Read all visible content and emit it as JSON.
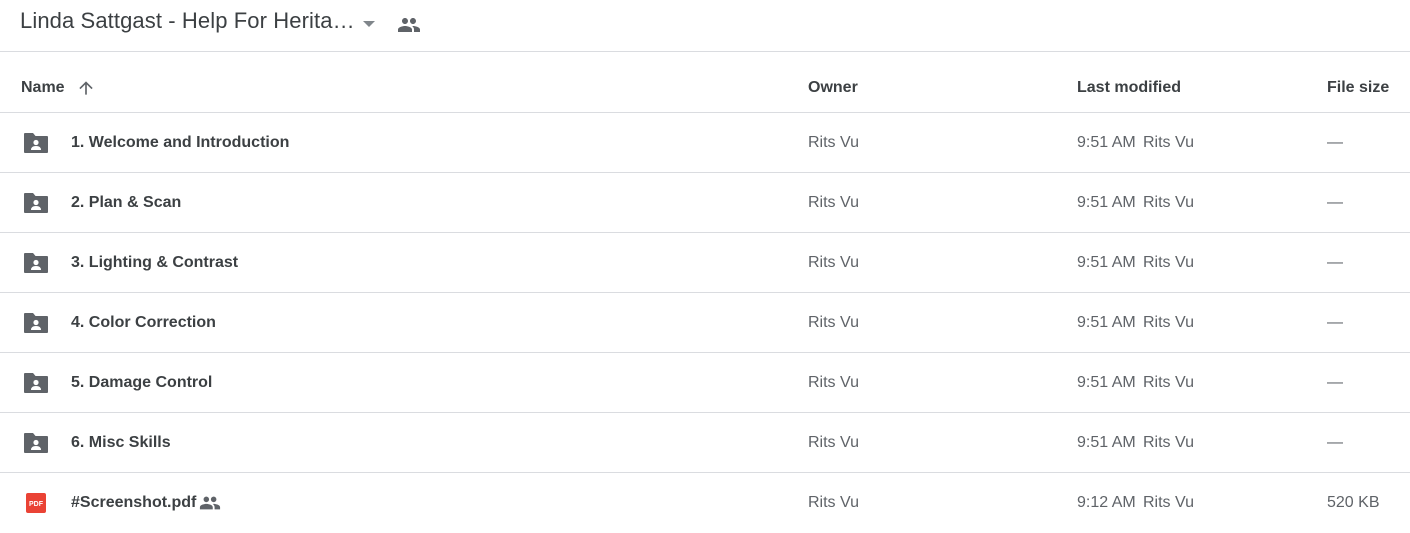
{
  "folder": {
    "title": "Linda Sattgast - Help For Herita…",
    "title_icons": [
      "caret-down-icon",
      "people-icon"
    ]
  },
  "columns": {
    "name": "Name",
    "owner": "Owner",
    "last_modified": "Last modified",
    "file_size": "File size",
    "sort": {
      "column": "name",
      "direction": "ascending",
      "icon": "arrow-up-icon"
    }
  },
  "rows": [
    {
      "icon": "shared-folder-icon",
      "name": "1. Welcome and Introduction",
      "owner": "Rits Vu",
      "modified_time": "9:51 AM",
      "modified_by": "Rits Vu",
      "size": "—"
    },
    {
      "icon": "shared-folder-icon",
      "name": "2. Plan & Scan",
      "owner": "Rits Vu",
      "modified_time": "9:51 AM",
      "modified_by": "Rits Vu",
      "size": "—"
    },
    {
      "icon": "shared-folder-icon",
      "name": "3. Lighting & Contrast",
      "owner": "Rits Vu",
      "modified_time": "9:51 AM",
      "modified_by": "Rits Vu",
      "size": "—"
    },
    {
      "icon": "shared-folder-icon",
      "name": "4. Color Correction",
      "owner": "Rits Vu",
      "modified_time": "9:51 AM",
      "modified_by": "Rits Vu",
      "size": "—"
    },
    {
      "icon": "shared-folder-icon",
      "name": "5. Damage Control",
      "owner": "Rits Vu",
      "modified_time": "9:51 AM",
      "modified_by": "Rits Vu",
      "size": "—"
    },
    {
      "icon": "shared-folder-icon",
      "name": "6. Misc Skills",
      "owner": "Rits Vu",
      "modified_time": "9:51 AM",
      "modified_by": "Rits Vu",
      "size": "—"
    },
    {
      "icon": "pdf-icon",
      "name": "#Screenshot.pdf",
      "shared": true,
      "owner": "Rits Vu",
      "modified_time": "9:12 AM",
      "modified_by": "Rits Vu",
      "size": "520 KB"
    }
  ],
  "colors": {
    "text": "#3c4043",
    "secondary_text": "#5f6368",
    "divider": "#dadce0",
    "pdf_red": "#ea4335"
  }
}
